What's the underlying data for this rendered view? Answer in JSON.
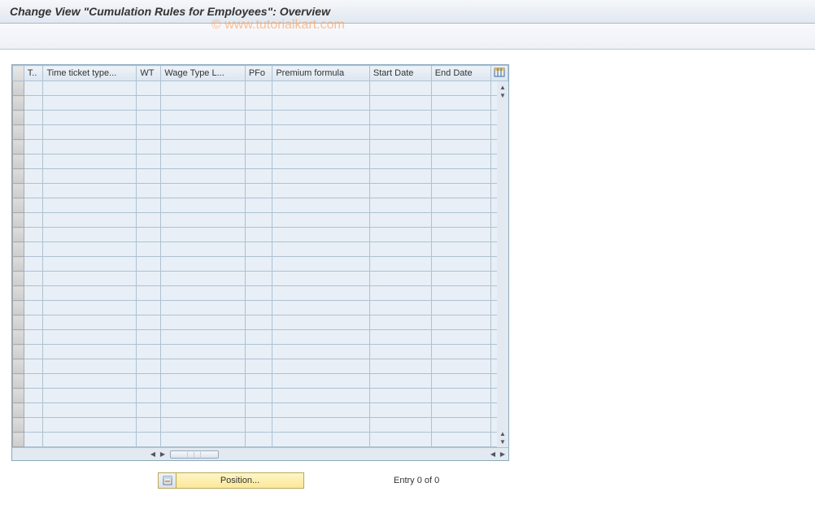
{
  "header": {
    "title": "Change View \"Cumulation Rules for Employees\": Overview"
  },
  "watermark": "© www.tutorialkart.com",
  "table": {
    "columns": [
      {
        "key": "t",
        "label": "T.."
      },
      {
        "key": "ttt",
        "label": "Time ticket type..."
      },
      {
        "key": "wt",
        "label": "WT"
      },
      {
        "key": "wtl",
        "label": "Wage Type L..."
      },
      {
        "key": "pfo",
        "label": "PFo"
      },
      {
        "key": "pf",
        "label": "Premium formula"
      },
      {
        "key": "sd",
        "label": "Start Date"
      },
      {
        "key": "ed",
        "label": "End Date"
      }
    ],
    "row_count": 25
  },
  "footer": {
    "position_button": "Position...",
    "entry_status": "Entry 0 of 0"
  }
}
